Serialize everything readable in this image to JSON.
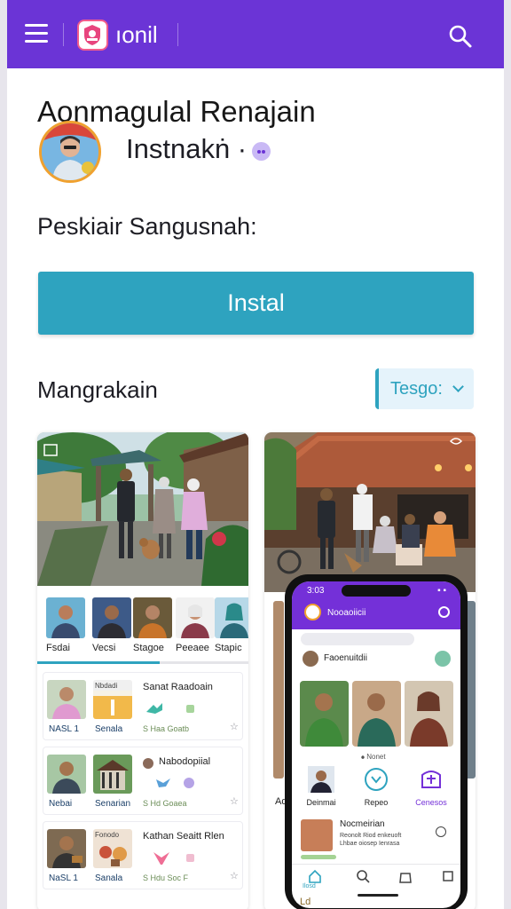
{
  "header": {
    "brand_name": "ıonil",
    "menu_icon": "hamburger-icon",
    "search_icon": "search-icon",
    "bar_color": "#6b34d6"
  },
  "app": {
    "title": "Aonmagulal Renajain",
    "developer": "Instnakṅ ·",
    "install_label": "Peskiair Sangusnah:",
    "install_button": "Instal",
    "accent_color": "#2ea3bf"
  },
  "section": {
    "title": "Mangrakain",
    "dropdown_value": "Tesgo:"
  },
  "left_card": {
    "strip": [
      {
        "label": "Fsdai"
      },
      {
        "label": "Vecsi"
      },
      {
        "label": "Stagoe"
      },
      {
        "label": "Peeaee"
      },
      {
        "label": "Stapic"
      }
    ],
    "progress_fraction": 0.58,
    "rows": [
      {
        "name": "NASL 1",
        "sub": "Senala",
        "title": "Sanat Raadoain",
        "thumb_text": "Nbdadi",
        "meta": "S Haa Goatb"
      },
      {
        "name": "Nebai",
        "sub": "Senarian",
        "title": "Nabodopiial",
        "meta": "S Hd Goaea"
      },
      {
        "name": "NaSL 1",
        "sub": "Sanala",
        "title": "Kathan Seaitt Rlen",
        "thumb_text": "Fonodo",
        "meta": "S Hdu Soc F"
      }
    ]
  },
  "right_card": {
    "peek_labels": [
      "Ad"
    ]
  },
  "phone": {
    "status_time": "3:03",
    "status_icons": "▪ ▪",
    "app_title": "Nooaoiicii",
    "user_name": "Faoenuitdii",
    "card_caption": "⦁ Nonet",
    "actions": [
      {
        "label": "Deinmai"
      },
      {
        "label": "Repeo"
      },
      {
        "label": "Cenesos"
      }
    ],
    "item": {
      "title": "Nocmeirian",
      "line1": "Reonolt Riod enkeuoft",
      "line2": "Lhbae oiosep Ienrasa"
    },
    "tab_label": "Ilosd",
    "bottom_text": "Ld"
  }
}
